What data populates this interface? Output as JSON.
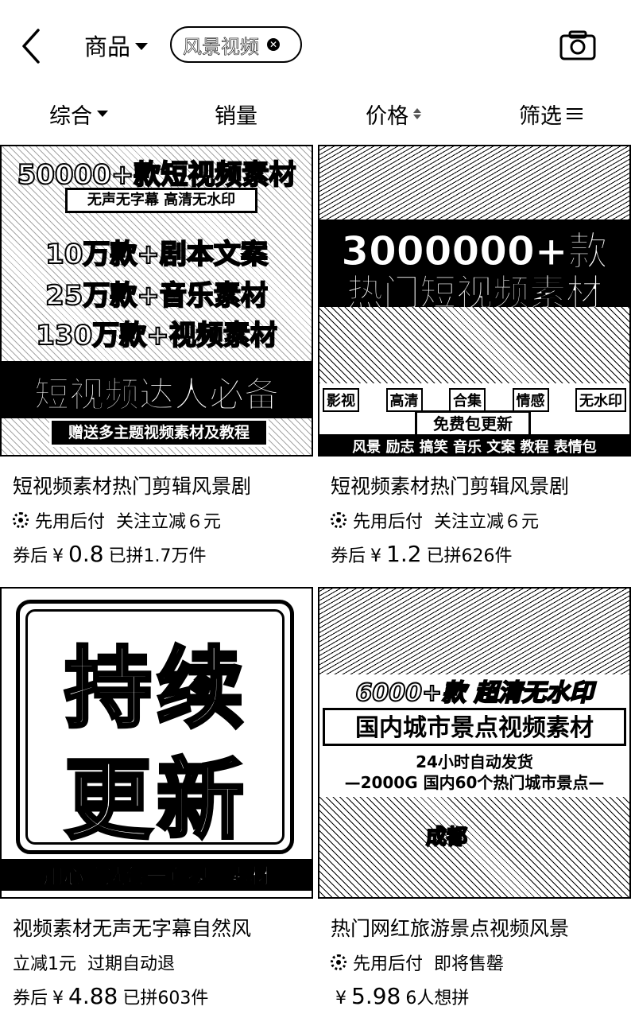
{
  "header": {
    "category_label": "商品",
    "search_chip": "风景视频"
  },
  "sort_bar": {
    "comprehensive": "综合",
    "sales": "销量",
    "price": "价格",
    "filter": "筛选"
  },
  "products": [
    {
      "thumb": {
        "line1": "50000+款短视频素材",
        "line2": "无声无字幕 高清无水印",
        "line3": "10万款+剧本文案",
        "line4": "25万款+音乐素材",
        "line5": "130万款+视频素材",
        "line6": "短视频达人必备",
        "line7": "赠送多主题视频素材及教程"
      },
      "title": "短视频素材热门剪辑风景剧",
      "promo1": "先用后付",
      "promo2": "关注立减６元",
      "price_prefix": "券后",
      "currency": "¥",
      "price": "0.8",
      "sales": "已拼1.7万件"
    },
    {
      "thumb": {
        "line1": "3000000+款",
        "line2": "热门短视频素材",
        "tags": [
          "影视",
          "高清",
          "合集",
          "情感",
          "无水印"
        ],
        "line3": "免费包更新",
        "line4": "风景 励志 搞笑 音乐 文案 教程 表情包"
      },
      "title": "短视频素材热门剪辑风景剧",
      "promo1": "先用后付",
      "promo2": "关注立减６元",
      "price_prefix": "券后",
      "currency": "¥",
      "price": "1.2",
      "sales": "已拼626件"
    },
    {
      "thumb": {
        "line1": "持续",
        "line2": "更新",
        "line3": "用心筛选每一套视频素材"
      },
      "title": "视频素材无声无字幕自然风",
      "promo1": "立减1元",
      "promo2": "过期自动退",
      "price_prefix": "券后",
      "currency": "¥",
      "price": "4.88",
      "sales": "已拼603件"
    },
    {
      "thumb": {
        "line1": "6000+款 超清无水印",
        "line2": "国内城市景点视频素材",
        "line3": "24小时自动发货",
        "line4": "—2000G 国内60个热门城市景点—",
        "line5": "成都"
      },
      "title": "热门网红旅游景点视频风景",
      "promo1": "先用后付",
      "promo2": "即将售罄",
      "price_prefix": "",
      "currency": "¥",
      "price": "5.98",
      "sales": "6人想拼"
    }
  ]
}
